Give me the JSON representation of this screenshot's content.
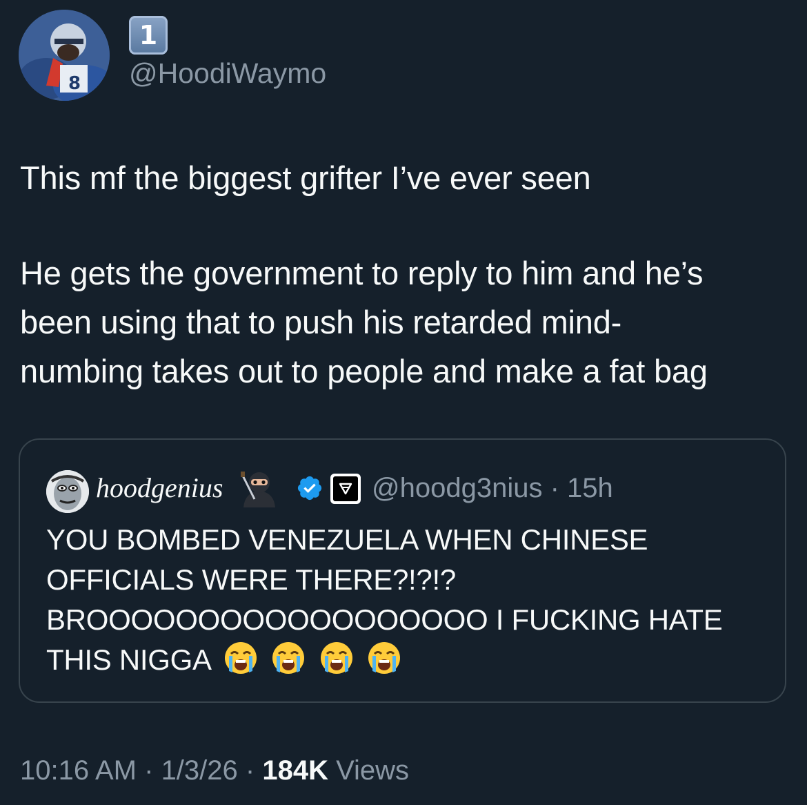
{
  "author": {
    "badge": "1",
    "handle": "@HoodiWaymo"
  },
  "tweet": {
    "paragraph1": "This mf the biggest grifter I’ve ever seen",
    "paragraph2_line1": "He gets the government to reply to him and he’s",
    "paragraph2_line2": "been using that to push his retarded mind-",
    "paragraph2_line3": "numbing takes out to people and make a fat bag"
  },
  "quote": {
    "name": "hoodgenius",
    "handle": "@hoodg3nius",
    "separator": " · ",
    "time": "15h",
    "line1": "YOU BOMBED VENEZUELA WHEN CHINESE",
    "line2": "OFFICIALS WERE THERE?!?!?",
    "line3": "BROOOOOOOOOOOOOOOOOO I FUCKING HATE",
    "line4": "THIS NIGGA",
    "icons": [
      "ninja-icon",
      "verified-icon",
      "affiliate-icon",
      "crying-face-icon"
    ]
  },
  "footer": {
    "time": "10:16 AM",
    "sep1": " · ",
    "date": "1/3/26",
    "sep2": " · ",
    "views_count": "184K",
    "views_label": " Views"
  },
  "colors": {
    "background": "#15202b",
    "text": "#f7f9f9",
    "muted": "#8b98a5",
    "border": "#38444d",
    "verified": "#1d9bf0"
  }
}
